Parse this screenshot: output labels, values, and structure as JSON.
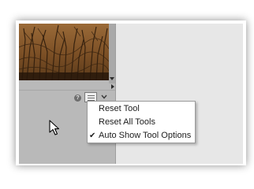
{
  "menu": {
    "items": [
      {
        "label": "Reset Tool",
        "checked": false
      },
      {
        "label": "Reset All Tools",
        "checked": false
      },
      {
        "label": "Auto Show Tool Options",
        "checked": true
      }
    ],
    "check_glyph": "✔"
  },
  "toolbar": {
    "help_glyph": "?"
  },
  "icons": {
    "help": "help-icon",
    "tool_options": "tool-options-icon",
    "dropdown": "chevron-down-icon",
    "cursor": "mouse-pointer-icon"
  },
  "colors": {
    "panel_gray": "#b9b9b9",
    "right_panel": "#e7e7e7",
    "menu_bg": "#ffffff",
    "photo_tone": "#8a5a2b"
  }
}
